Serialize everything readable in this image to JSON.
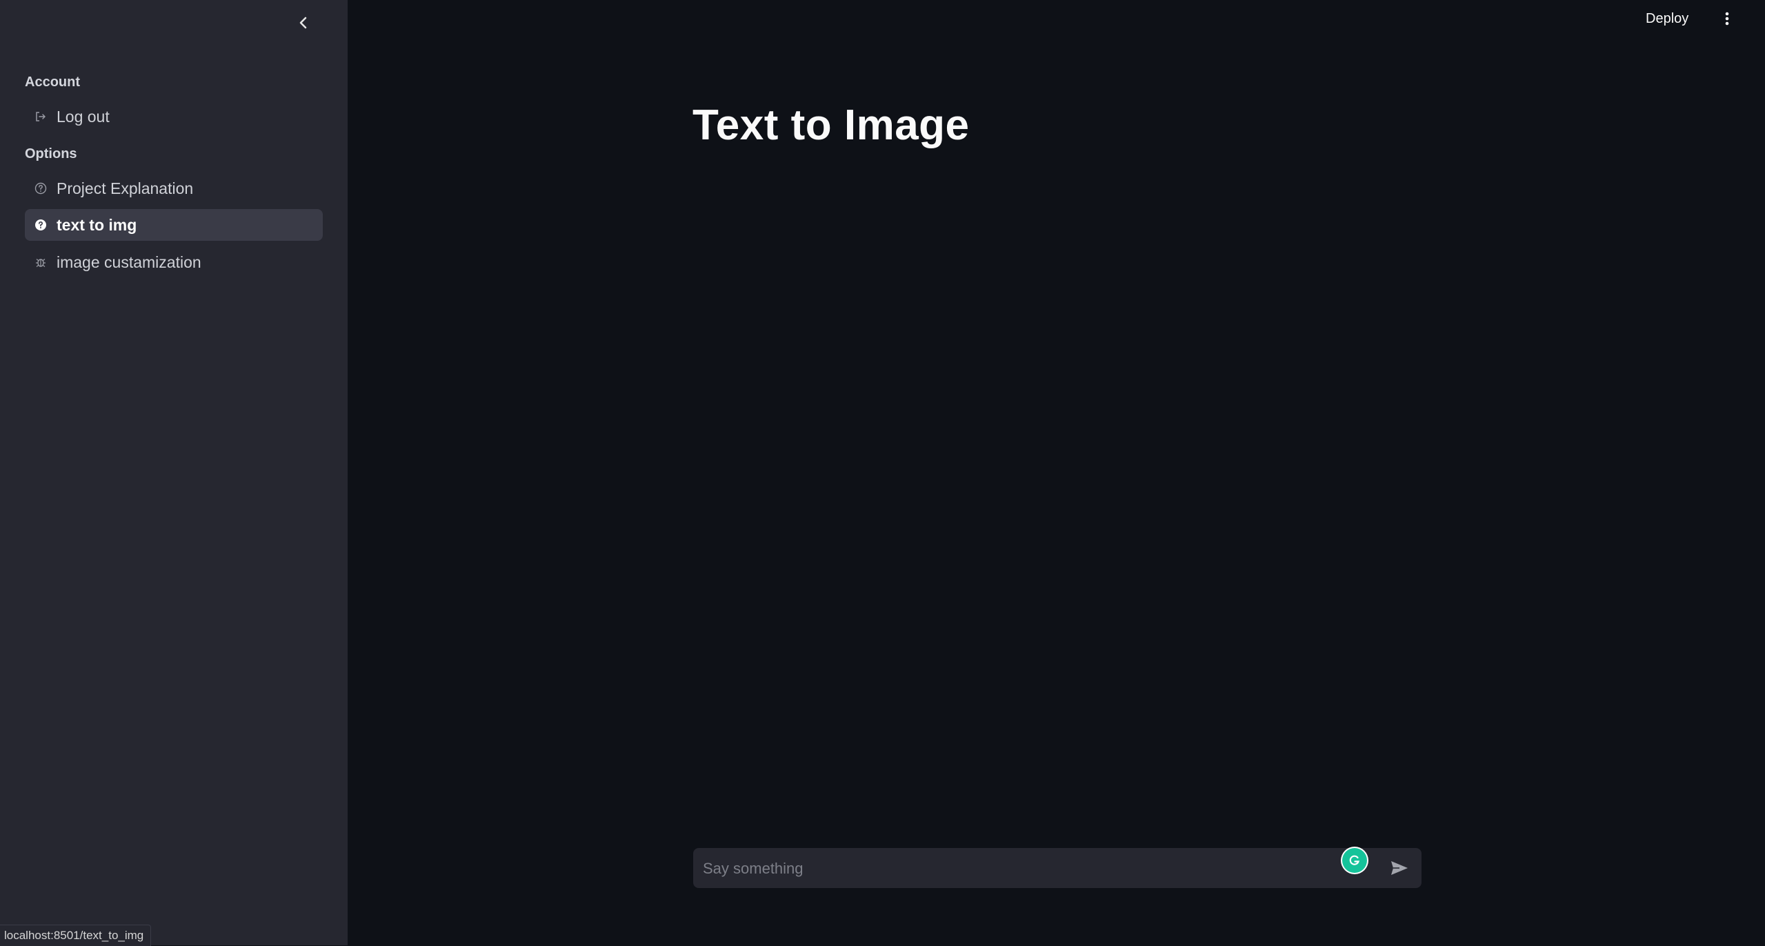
{
  "sidebar": {
    "sections": [
      {
        "title": "Account"
      },
      {
        "title": "Options"
      }
    ],
    "items": [
      {
        "label": "Log out",
        "icon": "logout-icon"
      },
      {
        "label": "Project Explanation",
        "icon": "question-circle-icon"
      },
      {
        "label": "text to img",
        "icon": "question-circle-icon",
        "active": true
      },
      {
        "label": "image custamization",
        "icon": "bug-icon"
      }
    ]
  },
  "header": {
    "deploy_label": "Deploy"
  },
  "main": {
    "title": "Text to Image"
  },
  "chat": {
    "placeholder": "Say something"
  },
  "status_bar": {
    "url": "localhost:8501/text_to_img"
  },
  "colors": {
    "background": "#0e1117",
    "sidebar": "#262730",
    "active_item": "#3a3b47",
    "grammarly": "#15c39a"
  }
}
